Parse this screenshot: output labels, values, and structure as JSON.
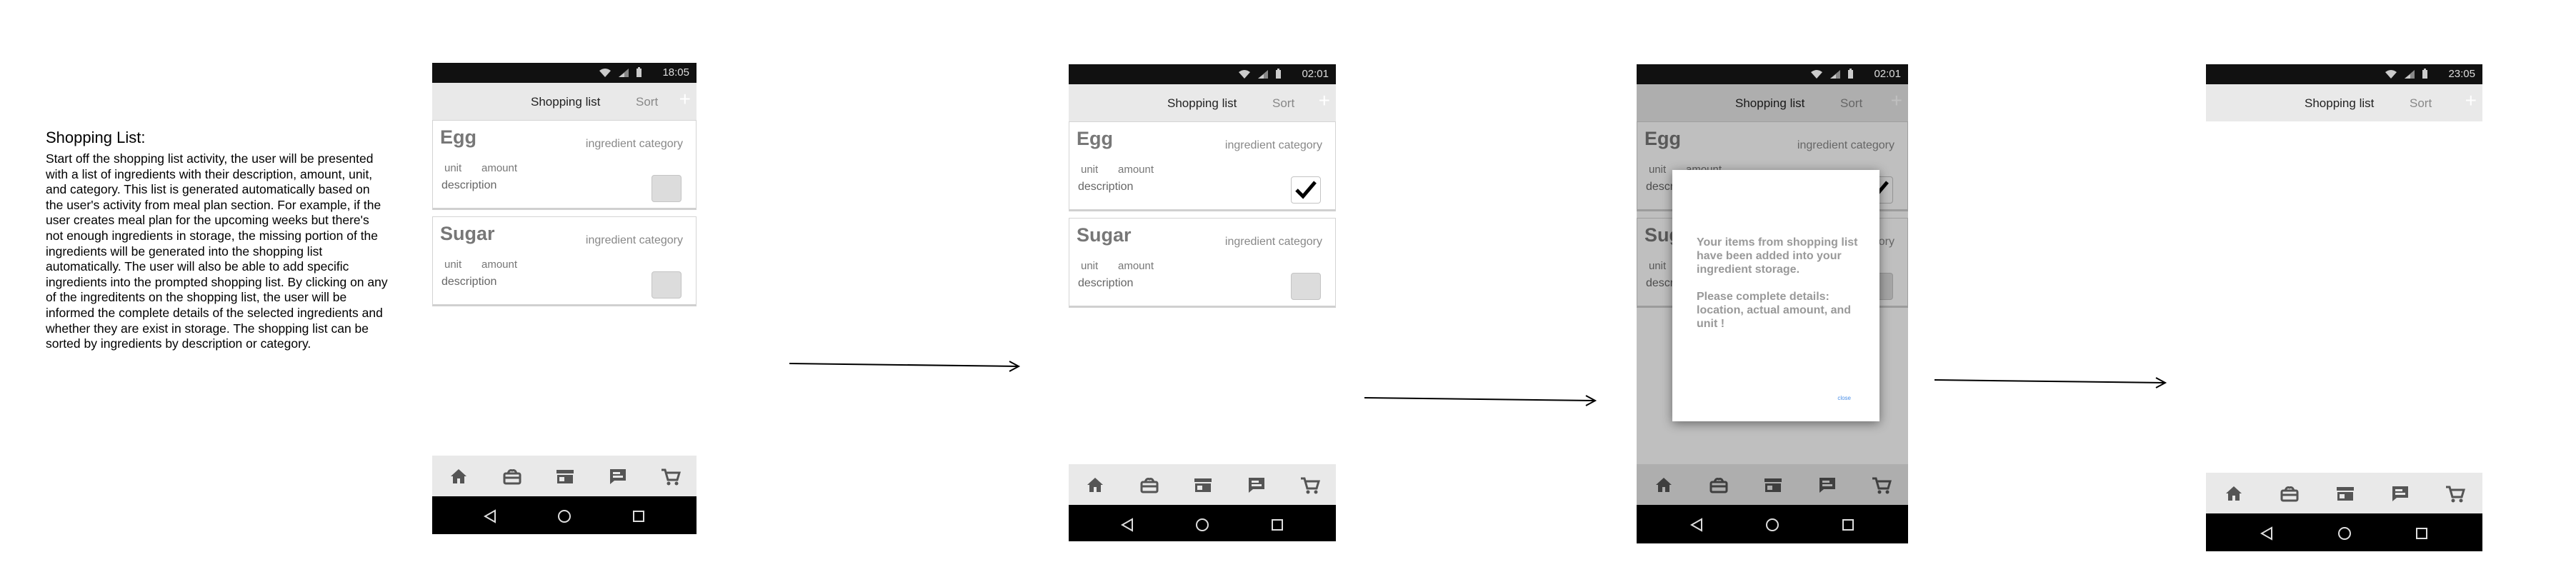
{
  "description": {
    "title": "Shopping List:",
    "body": "Start off the shopping list activity, the user will be presented with a list of ingredients with their description, amount, unit, and category. This list is generated automatically based on the user's activity from meal plan section. For example, if the user creates meal plan for the upcoming weeks but there's not enough ingredients in storage, the missing portion of the ingredients will be generated into the shopping list automatically. The user will also be able to add specific ingredients into the prompted shopping list. By clicking on any of the ingreditents on the shopping list, the user will be informed the complete details of the selected ingredients and whether they are exist in storage. The shopping list can be sorted by ingredients by description or category."
  },
  "phones": [
    {
      "time": "18:05",
      "title": "Shopping list",
      "sort": "Sort",
      "add_icon": "plus-icon",
      "items": [
        {
          "name": "Egg",
          "category": "ingredient category",
          "unit": "unit",
          "amount": "amount",
          "description": "description",
          "checked": false
        },
        {
          "name": "Sugar",
          "category": "ingredient category",
          "unit": "unit",
          "amount": "amount",
          "description": "description",
          "checked": false
        }
      ]
    },
    {
      "time": "02:01",
      "title": "Shopping list",
      "sort": "Sort",
      "add_icon": "plus-icon",
      "items": [
        {
          "name": "Egg",
          "category": "ingredient category",
          "unit": "unit",
          "amount": "amount",
          "description": "description",
          "checked": true
        },
        {
          "name": "Sugar",
          "category": "ingredient category",
          "unit": "unit",
          "amount": "amount",
          "description": "description",
          "checked": false
        }
      ]
    },
    {
      "time": "02:01",
      "title": "Shopping list",
      "sort": "Sort",
      "add_icon": "plus-icon",
      "items": [
        {
          "name": "Egg",
          "category": "ingredient category",
          "unit": "unit",
          "amount": "amount",
          "description": "description",
          "checked": true
        },
        {
          "name": "Sugar",
          "category": "ingredient category",
          "unit": "unit",
          "amount": "amount",
          "description": "description",
          "checked": false
        }
      ],
      "dialog": {
        "message": "Your items from shopping list have been added into your ingredient storage.\n\nPlease complete details: location, actual amount, and unit !",
        "button": "close"
      }
    },
    {
      "time": "23:05",
      "title": "Shopping list",
      "sort": "Sort",
      "add_icon": "plus-icon",
      "items": []
    }
  ],
  "bottom_nav_icons": [
    "home-icon",
    "storage-icon",
    "store-icon",
    "meal-plan-icon",
    "cart-icon"
  ],
  "system_nav_icons": [
    "back-icon",
    "home-circle-icon",
    "recents-icon"
  ],
  "colors": {
    "status_bar": "#111111",
    "app_bar": "#e9e9e9",
    "card_title": "#777777",
    "dialog_button": "#4a8fe8"
  }
}
